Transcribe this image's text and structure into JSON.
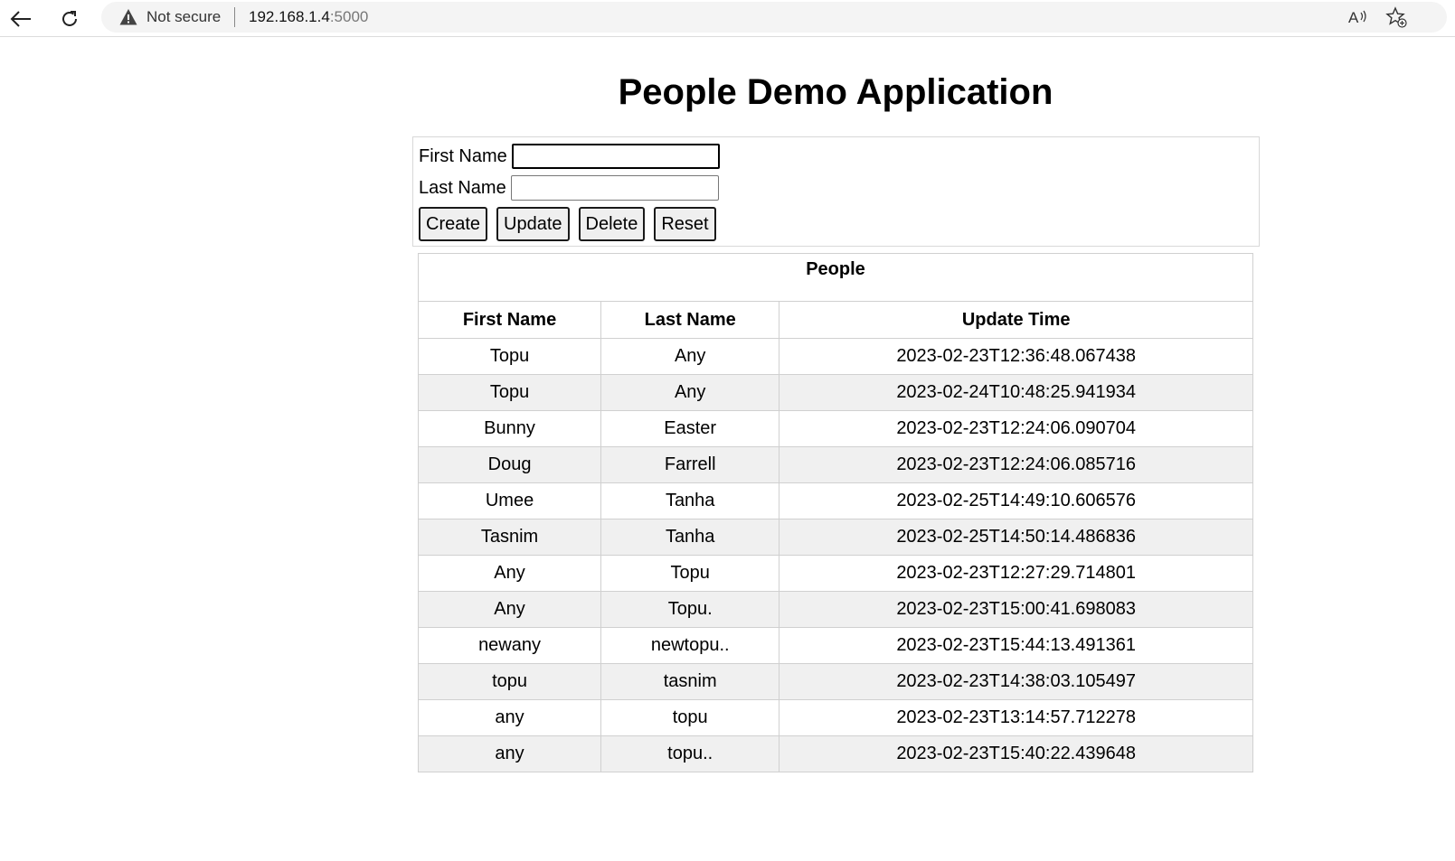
{
  "browser": {
    "security_label": "Not secure",
    "url_host": "192.168.1.4",
    "url_port": ":5000",
    "icons": {
      "back": "back-arrow-icon",
      "reload": "reload-icon",
      "warning": "warning-icon",
      "read_aloud": "read-aloud-icon",
      "favorite": "add-favorite-icon"
    }
  },
  "page": {
    "title": "People Demo Application"
  },
  "form": {
    "first_name_label": "First Name",
    "first_name_value": "",
    "last_name_label": "Last Name",
    "last_name_value": "",
    "buttons": {
      "create": "Create",
      "update": "Update",
      "delete": "Delete",
      "reset": "Reset"
    }
  },
  "table": {
    "caption": "People",
    "headers": [
      "First Name",
      "Last Name",
      "Update Time"
    ],
    "rows": [
      [
        "Topu",
        "Any",
        "2023-02-23T12:36:48.067438"
      ],
      [
        "Topu",
        "Any",
        "2023-02-24T10:48:25.941934"
      ],
      [
        "Bunny",
        "Easter",
        "2023-02-23T12:24:06.090704"
      ],
      [
        "Doug",
        "Farrell",
        "2023-02-23T12:24:06.085716"
      ],
      [
        "Umee",
        "Tanha",
        "2023-02-25T14:49:10.606576"
      ],
      [
        "Tasnim",
        "Tanha",
        "2023-02-25T14:50:14.486836"
      ],
      [
        "Any",
        "Topu",
        "2023-02-23T12:27:29.714801"
      ],
      [
        "Any",
        "Topu.",
        "2023-02-23T15:00:41.698083"
      ],
      [
        "newany",
        "newtopu..",
        "2023-02-23T15:44:13.491361"
      ],
      [
        "topu",
        "tasnim",
        "2023-02-23T14:38:03.105497"
      ],
      [
        "any",
        "topu",
        "2023-02-23T13:14:57.712278"
      ],
      [
        "any",
        "topu..",
        "2023-02-23T15:40:22.439648"
      ]
    ]
  }
}
